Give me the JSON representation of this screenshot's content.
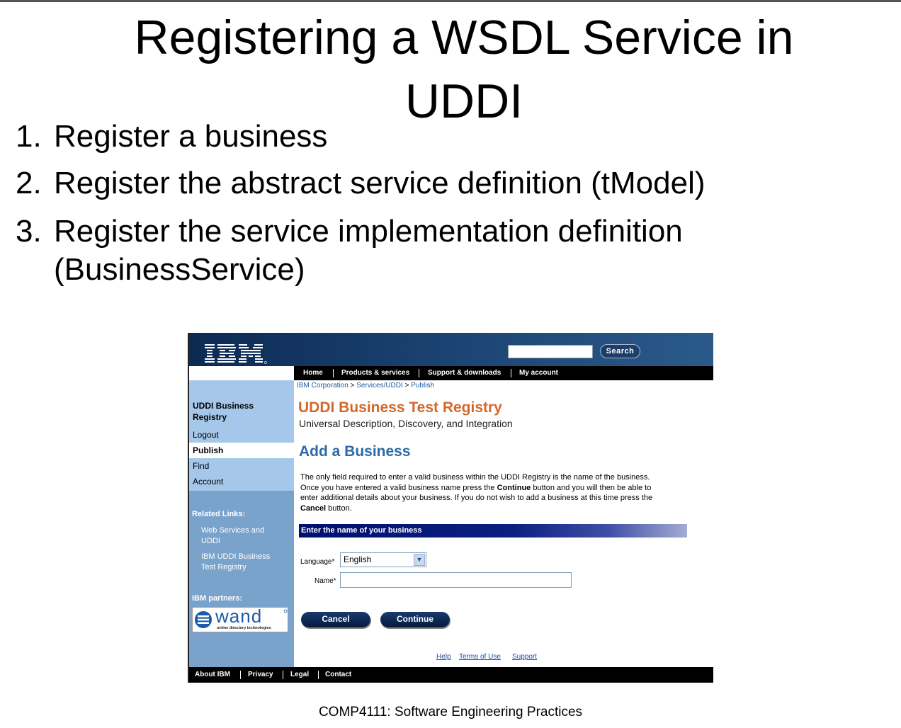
{
  "slide": {
    "title_line1": "Registering a WSDL Service in",
    "title_line2": "UDDI",
    "steps": [
      {
        "num": "1.",
        "text": "Register a business",
        "cont": ""
      },
      {
        "num": "2.",
        "text": "Register the abstract service definition (tModel)",
        "cont": ""
      },
      {
        "num": "3.",
        "text": "Register the service implementation definition",
        "cont": "(BusinessService)"
      }
    ],
    "footer": "COMP4111: Software Engineering Practices"
  },
  "screenshot": {
    "logo": "IBM",
    "search": {
      "value": "",
      "button": "Search"
    },
    "topnav": [
      "Home",
      "Products & services",
      "Support & downloads",
      "My account"
    ],
    "breadcrumb": [
      "IBM Corporation",
      "Services/UDDI",
      "Publish"
    ],
    "breadcrumb_sep": ">",
    "sidebar": {
      "registry_title_l1": "UDDI Business",
      "registry_title_l2": "Registry",
      "items": [
        "Logout",
        "Publish",
        "Find",
        "Account"
      ],
      "related_header": "Related Links:",
      "related_links": [
        {
          "l1": "Web Services and",
          "l2": "UDDI"
        },
        {
          "l1": "IBM UDDI Business",
          "l2": "Test Registry"
        }
      ],
      "partners_header": "IBM partners:",
      "partner_logo": "wand",
      "partner_tagline": "online directory technologies"
    },
    "main": {
      "title": "UDDI Business Test Registry",
      "subtitle": "Universal Description, Discovery, and Integration",
      "heading": "Add a Business",
      "intro_a": "The only field required to enter a valid business within the UDDI Registry is the name of the business. Once you have entered a valid business name press the ",
      "intro_b": "Continue",
      "intro_c": " button and you will then be able to enter additional details about your business. If you do not wish to add a business at this time press the ",
      "intro_d": "Cancel",
      "intro_e": " button.",
      "bar": "Enter the name of your business",
      "language_label": "Language*",
      "language_value": "English",
      "name_label": "Name*",
      "name_value": "",
      "cancel": "Cancel",
      "continue": "Continue",
      "footer_links": [
        "Help",
        "Terms of Use",
        "Support"
      ]
    },
    "bottomnav": [
      "About IBM",
      "Privacy",
      "Legal",
      "Contact"
    ]
  }
}
